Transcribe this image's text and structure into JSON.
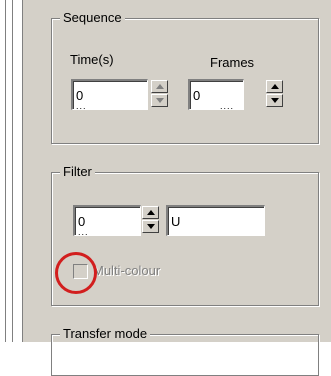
{
  "sequence": {
    "legend": "Sequence",
    "time_label": "Time(s)",
    "frames_label": "Frames",
    "time_value": "0",
    "time_overflow": "...",
    "frames_value": "0",
    "frames_overflow": "...."
  },
  "filter": {
    "legend": "Filter",
    "number_value": "0",
    "number_overflow": "...",
    "text_value": "U",
    "multicolour_label": "Multi-colour",
    "multicolour_checked": false
  },
  "transfer": {
    "legend": "Transfer mode"
  },
  "colors": {
    "panel": "#d4d0c8",
    "annotation_circle": "#d21e1e"
  }
}
